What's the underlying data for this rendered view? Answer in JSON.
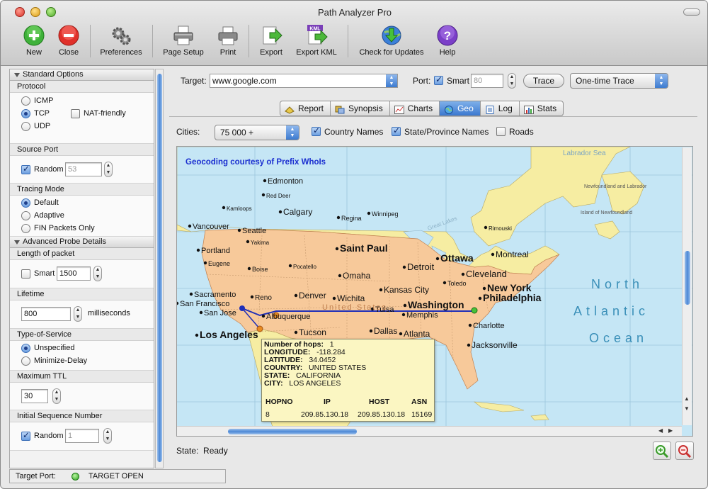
{
  "window": {
    "title": "Path Analyzer Pro"
  },
  "toolbar": {
    "new": "New",
    "close": "Close",
    "preferences": "Preferences",
    "page_setup": "Page Setup",
    "print": "Print",
    "export": "Export",
    "export_kml": "Export KML",
    "kml_badge": "KML",
    "check_updates": "Check for Updates",
    "help": "Help"
  },
  "left": {
    "standard_options": "Standard Options",
    "protocol": {
      "label": "Protocol",
      "icmp": "ICMP",
      "tcp": "TCP",
      "udp": "UDP",
      "nat": "NAT-friendly",
      "selected": "TCP",
      "nat_checked": false
    },
    "source_port": {
      "label": "Source Port",
      "random": "Random",
      "value": "53",
      "random_checked": true
    },
    "tracing_mode": {
      "label": "Tracing Mode",
      "default": "Default",
      "adaptive": "Adaptive",
      "fin": "FIN Packets Only",
      "selected": "Default"
    },
    "advanced": "Advanced Probe Details",
    "length": {
      "label": "Length of packet",
      "smart": "Smart",
      "value": "1500",
      "smart_checked": false
    },
    "lifetime": {
      "label": "Lifetime",
      "value": "800",
      "unit": "milliseconds"
    },
    "tos": {
      "label": "Type-of-Service",
      "unspecified": "Unspecified",
      "minimize": "Minimize-Delay",
      "selected": "Unspecified"
    },
    "max_ttl": {
      "label": "Maximum TTL",
      "value": "30"
    },
    "isn": {
      "label": "Initial Sequence Number",
      "random": "Random",
      "value": "1",
      "random_checked": true
    }
  },
  "status": {
    "target_port_label": "Target Port:",
    "target_port_value": "TARGET OPEN"
  },
  "target": {
    "label": "Target:",
    "value": "www.google.com"
  },
  "port": {
    "label": "Port:",
    "smart": "Smart",
    "value": "80",
    "smart_checked": true
  },
  "trace_button": "Trace",
  "trace_mode": "One-time Trace",
  "tabs": [
    "Report",
    "Synopsis",
    "Charts",
    "Geo",
    "Log",
    "Stats"
  ],
  "active_tab": "Geo",
  "geo": {
    "cities_label": "Cities:",
    "cities_value": "75 000 +",
    "country_names": "Country Names",
    "state_names": "State/Province Names",
    "roads": "Roads",
    "country_checked": true,
    "state_checked": true,
    "roads_checked": false,
    "credit": "Geocoding courtesy of Prefix WhoIs"
  },
  "map": {
    "cities": [
      "Edmonton",
      "Red Deer",
      "Kamloops",
      "Calgary",
      "Regina",
      "Winnipeg",
      "Vancouver",
      "Seattle",
      "Yakima",
      "Portland",
      "Eugene",
      "Boise",
      "Pocatello",
      "Saint Paul",
      "Detroit",
      "Ottawa",
      "Montreal",
      "Rimouski",
      "Cleveland",
      "Toledo",
      "Omaha",
      "Kansas City",
      "New York",
      "Philadelphia",
      "Washington",
      "Sacramento",
      "San Francisco",
      "San Jose",
      "Reno",
      "Denver",
      "Wichita",
      "Albuquerque",
      "Tulsa",
      "Memphis",
      "Charlotte",
      "Los Angeles",
      "Tucson",
      "Dallas",
      "Atlanta",
      "Jacksonville"
    ],
    "regions": [
      "Great Lakes",
      "United States",
      "Newfoundland and Labrador",
      "Island of Newfoundland",
      "Labrador Sea"
    ],
    "ocean": [
      "North",
      "Atlantic",
      "Ocean"
    ],
    "route_color": "#1f2fb8"
  },
  "tooltip": {
    "hops_label": "Number of hops:",
    "hops": "1",
    "lon_label": "LONGITUDE:",
    "lon": "-118.284",
    "lat_label": "LATITUDE:",
    "lat": "34.0452",
    "country_label": "COUNTRY:",
    "country": "UNITED STATES",
    "state_label": "STATE:",
    "state": "CALIFORNIA",
    "city_label": "CITY:",
    "city": "LOS ANGELES",
    "headers": [
      "HOPNO",
      "IP",
      "HOST",
      "ASN"
    ],
    "row": [
      "8",
      "209.85.130.18",
      "209.85.130.18",
      "15169"
    ]
  },
  "state": {
    "label": "State:",
    "value": "Ready"
  }
}
